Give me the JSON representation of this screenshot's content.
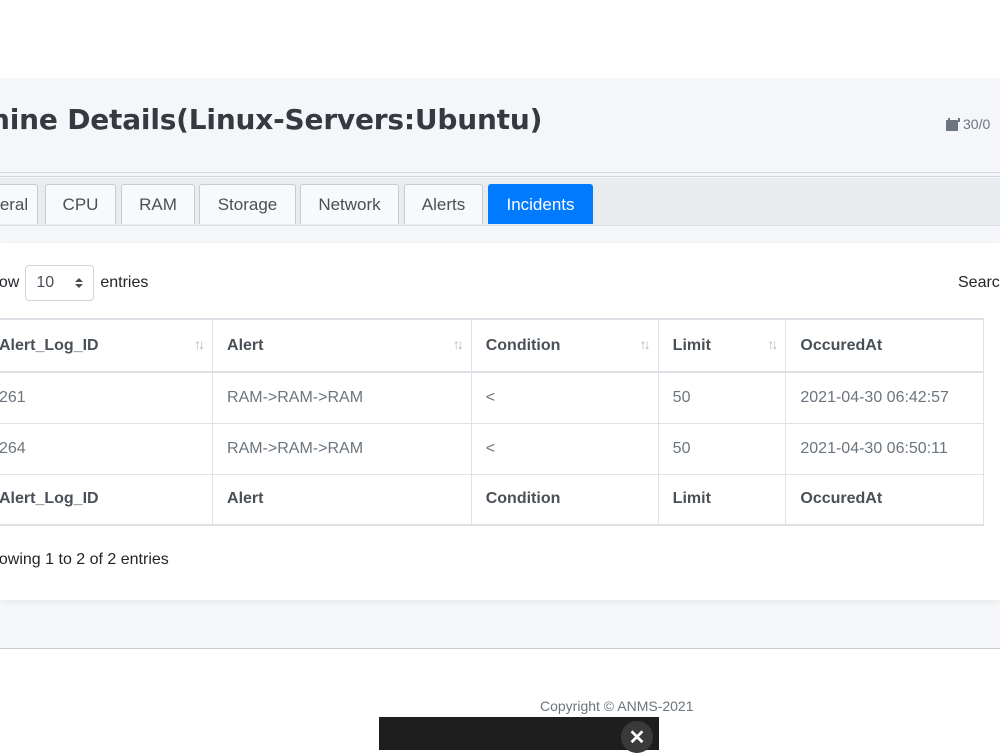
{
  "header": {
    "title": "hine Details(Linux-Servers:Ubuntu)",
    "date": "30/0"
  },
  "tabs": [
    {
      "label": "eral",
      "active": false
    },
    {
      "label": "CPU",
      "active": false
    },
    {
      "label": "RAM",
      "active": false
    },
    {
      "label": "Storage",
      "active": false
    },
    {
      "label": "Network",
      "active": false
    },
    {
      "label": "Alerts",
      "active": false
    },
    {
      "label": "Incidents",
      "active": true
    }
  ],
  "table_controls": {
    "show_label": "how",
    "entries_value": "10",
    "entries_label": "entries",
    "search_label": "Searc"
  },
  "table": {
    "columns": [
      "Alert_Log_ID",
      "Alert",
      "Condition",
      "Limit",
      "OccuredAt"
    ],
    "rows": [
      [
        "261",
        "RAM->RAM->RAM",
        "<",
        "50",
        "2021-04-30 06:42:57"
      ],
      [
        "264",
        "RAM->RAM->RAM",
        "<",
        "50",
        "2021-04-30 06:50:11"
      ]
    ],
    "info": "howing 1 to 2 of 2 entries"
  },
  "footer": {
    "copyright": "Copyright © ANMS-2021"
  },
  "overlay": {
    "close_glyph": "✕"
  },
  "colors": {
    "accent": "#007bff",
    "background": "#f4f6f9"
  }
}
